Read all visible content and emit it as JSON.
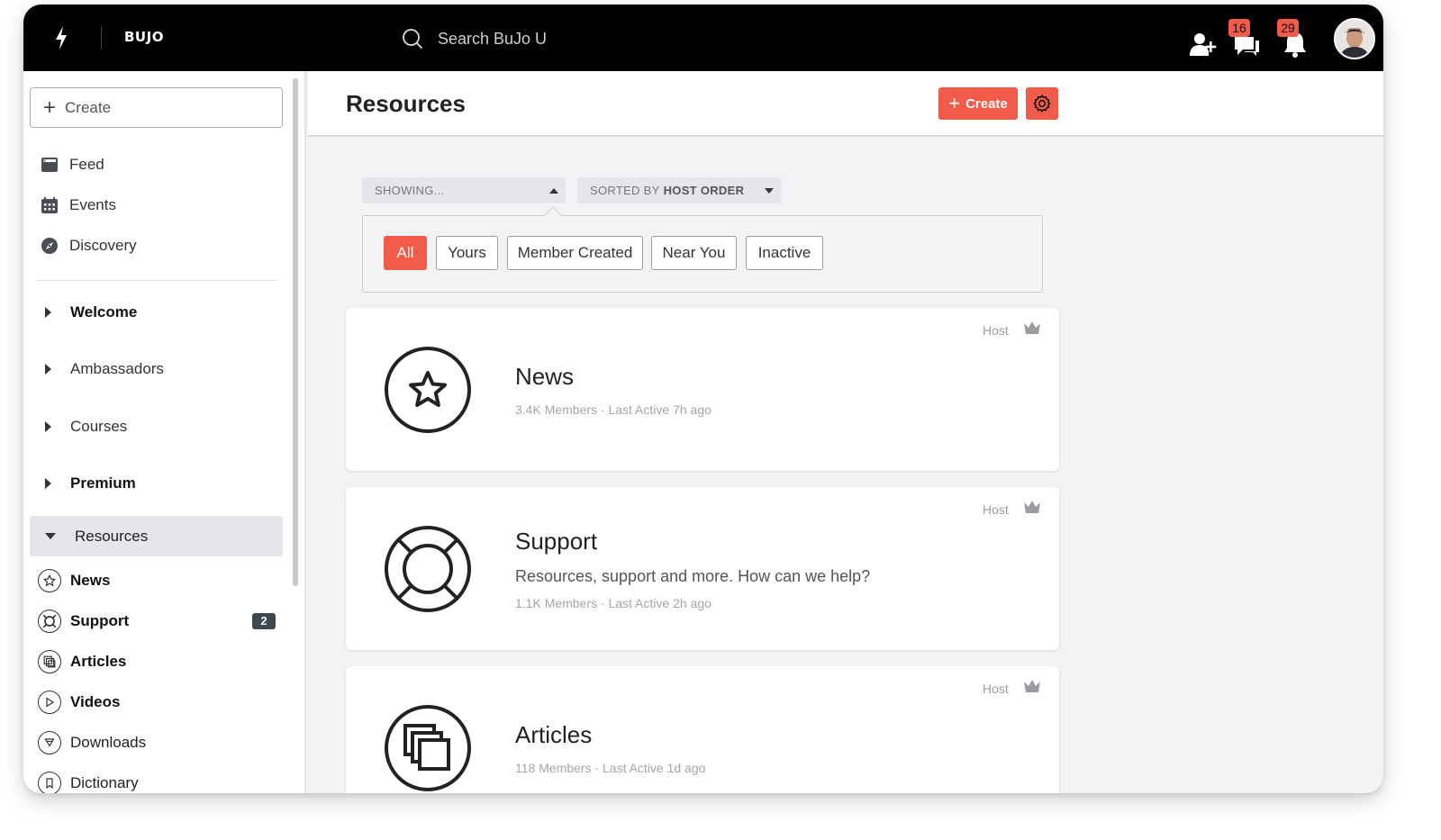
{
  "app": {
    "logo": "BUJO"
  },
  "search": {
    "placeholder": "Search BuJo U"
  },
  "notifications": {
    "messages_count": "16",
    "alerts_count": "29"
  },
  "sidebar": {
    "create_label": "Create",
    "nav": [
      {
        "label": "Feed",
        "icon": "feed-icon"
      },
      {
        "label": "Events",
        "icon": "calendar-icon"
      },
      {
        "label": "Discovery",
        "icon": "compass-icon"
      }
    ],
    "groups": [
      {
        "label": "Welcome",
        "bold": true
      },
      {
        "label": "Ambassadors",
        "bold": false
      },
      {
        "label": "Courses",
        "bold": false
      },
      {
        "label": "Premium",
        "bold": true
      }
    ],
    "active_group": "Resources",
    "resources": [
      {
        "label": "News",
        "icon": "star-icon",
        "bold": true
      },
      {
        "label": "Support",
        "icon": "lifebuoy-icon",
        "bold": true,
        "badge": "2"
      },
      {
        "label": "Articles",
        "icon": "copy-icon",
        "bold": true
      },
      {
        "label": "Videos",
        "icon": "play-icon",
        "bold": true
      },
      {
        "label": "Downloads",
        "icon": "download-icon",
        "bold": false
      },
      {
        "label": "Dictionary",
        "icon": "bookmark-icon",
        "bold": false
      }
    ]
  },
  "main": {
    "title": "Resources",
    "create_label": "Create",
    "showing_label": "SHOWING...",
    "sort_prefix": "SORTED BY",
    "sort_value": "HOST ORDER",
    "filters": [
      "All",
      "Yours",
      "Member Created",
      "Near You",
      "Inactive"
    ],
    "active_filter": "All",
    "cards": [
      {
        "title": "News",
        "description": "",
        "meta": "3.4K Members · Last Active 7h ago",
        "host_label": "Host",
        "icon": "star-icon"
      },
      {
        "title": "Support",
        "description": "Resources, support and more. How can we help?",
        "meta": "1.1K Members · Last Active 2h ago",
        "host_label": "Host",
        "icon": "lifebuoy-icon"
      },
      {
        "title": "Articles",
        "description": "",
        "meta": "118 Members · Last Active 1d ago",
        "host_label": "Host",
        "icon": "copy-icon"
      }
    ]
  },
  "colors": {
    "accent": "#f25a4a",
    "topbar": "#000000",
    "sidebar_active": "#e4e6ea"
  }
}
